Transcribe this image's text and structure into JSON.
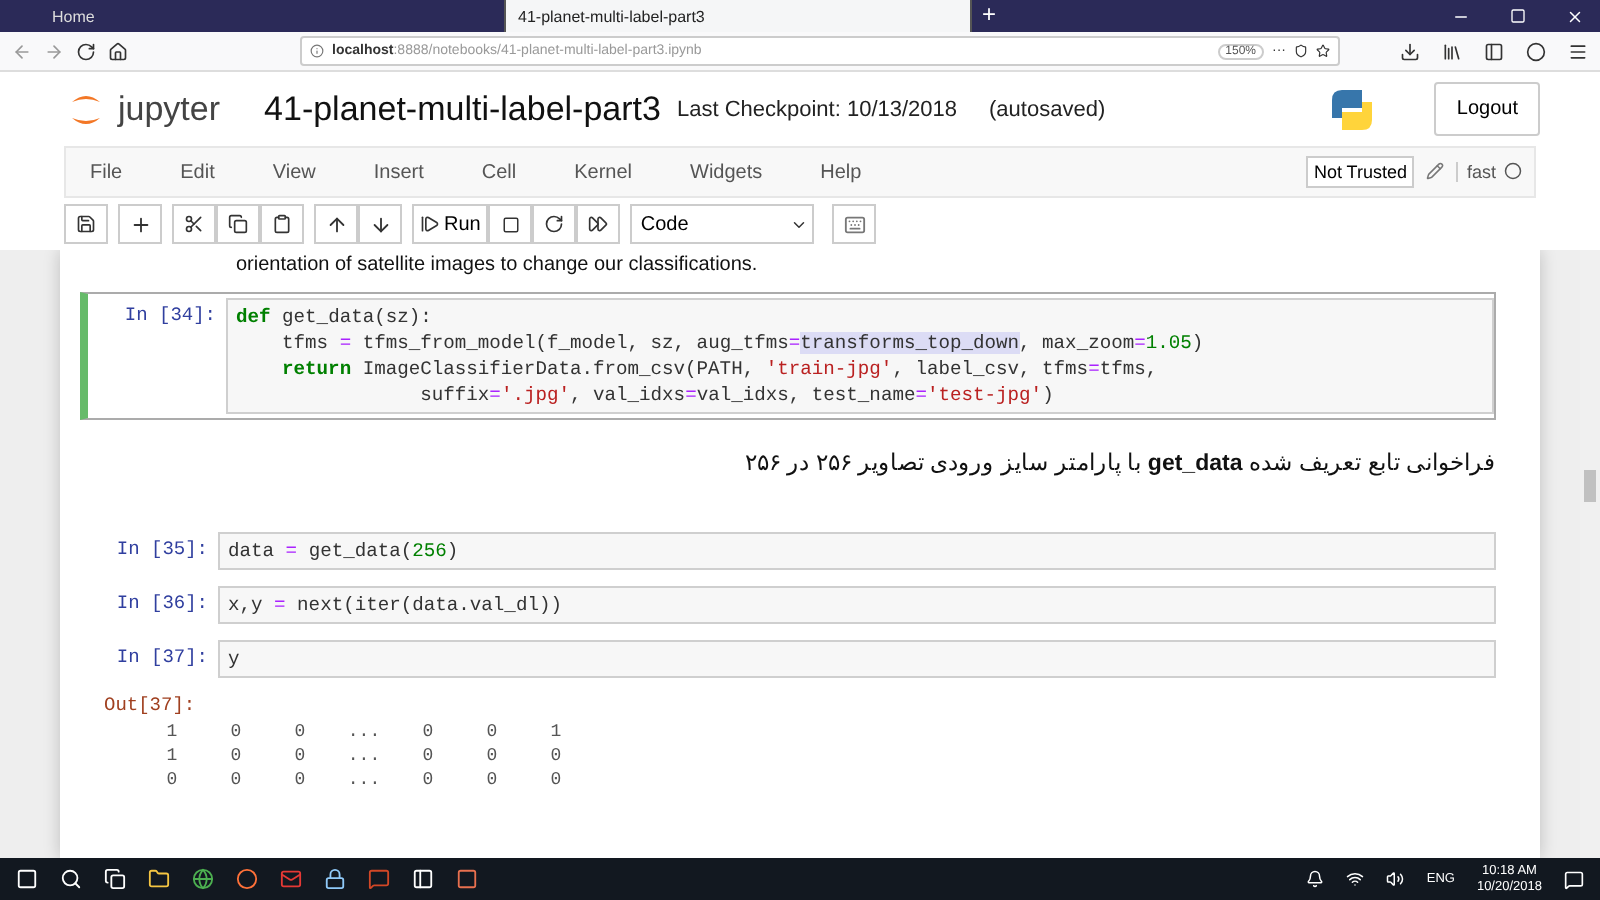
{
  "browser": {
    "tabs": [
      {
        "label": "Home",
        "selected": false
      },
      {
        "label": "41-planet-multi-label-part3",
        "selected": true
      }
    ],
    "new_tab": "+",
    "url_host": "localhost",
    "url_rest": ":8888/notebooks/41-planet-multi-label-part3.ipynb",
    "zoom": "150%",
    "dots": "···"
  },
  "header": {
    "logo_text": "jupyter",
    "title": "41-planet-multi-label-part3",
    "checkpoint": "Last Checkpoint: 10/13/2018",
    "autosaved": "(autosaved)",
    "logout": "Logout"
  },
  "menu": {
    "items": [
      "File",
      "Edit",
      "View",
      "Insert",
      "Cell",
      "Kernel",
      "Widgets",
      "Help"
    ],
    "trusted": "Not Trusted",
    "kernel": "fast"
  },
  "toolbar": {
    "run": "Run",
    "cell_type": "Code"
  },
  "notebook": {
    "intro": "orientation of satellite images to change our classifications.",
    "cells": [
      {
        "kind": "code",
        "prompt": "In [34]:",
        "selected": true,
        "lines": [
          [
            {
              "text": "def",
              "kind": "keyword"
            },
            {
              "text": " get_data(sz):",
              "kind": "plain"
            }
          ],
          [
            {
              "text": "    tfms ",
              "kind": "plain"
            },
            {
              "text": "=",
              "kind": "operator"
            },
            {
              "text": " tfms_from_model(f_model, sz, aug_tfms",
              "kind": "plain"
            },
            {
              "text": "=",
              "kind": "operator"
            },
            {
              "text": "transforms_top_down",
              "kind": "highlight"
            },
            {
              "text": ", max_zoom",
              "kind": "plain"
            },
            {
              "text": "=",
              "kind": "operator"
            },
            {
              "text": "1.05",
              "kind": "number"
            },
            {
              "text": ")",
              "kind": "plain"
            }
          ],
          [
            {
              "text": "    return",
              "kind": "keyword"
            },
            {
              "text": " ImageClassifierData.from_csv(PATH, ",
              "kind": "plain"
            },
            {
              "text": "'train-jpg'",
              "kind": "string"
            },
            {
              "text": ", label_csv, tfms",
              "kind": "plain"
            },
            {
              "text": "=",
              "kind": "operator"
            },
            {
              "text": "tfms,",
              "kind": "plain"
            }
          ],
          [
            {
              "text": "                suffix",
              "kind": "plain"
            },
            {
              "text": "=",
              "kind": "operator"
            },
            {
              "text": "'.jpg'",
              "kind": "string"
            },
            {
              "text": ", val_idxs",
              "kind": "plain"
            },
            {
              "text": "=",
              "kind": "operator"
            },
            {
              "text": "val_idxs, test_name",
              "kind": "plain"
            },
            {
              "text": "=",
              "kind": "operator"
            },
            {
              "text": "'test-jpg'",
              "kind": "string"
            },
            {
              "text": ")",
              "kind": "plain"
            }
          ]
        ]
      },
      {
        "kind": "markdown",
        "text": "فراخوانی تابع تعریف شده **get_data** با پارامتر سایز ورودی تصاویر ۲۵۶ در ۲۵۶"
      },
      {
        "kind": "code",
        "prompt": "In [35]:",
        "selected": false,
        "lines": [
          [
            {
              "text": "data ",
              "kind": "plain"
            },
            {
              "text": "=",
              "kind": "operator"
            },
            {
              "text": " get_data(",
              "kind": "plain"
            },
            {
              "text": "256",
              "kind": "number"
            },
            {
              "text": ")",
              "kind": "plain"
            }
          ]
        ]
      },
      {
        "kind": "code",
        "prompt": "In [36]:",
        "selected": false,
        "lines": [
          [
            {
              "text": "x,y ",
              "kind": "plain"
            },
            {
              "text": "=",
              "kind": "operator"
            },
            {
              "text": " next(iter(data.val_dl))",
              "kind": "plain"
            }
          ]
        ]
      },
      {
        "kind": "code",
        "prompt": "In [37]:",
        "selected": false,
        "lines": [
          [
            {
              "text": "y",
              "kind": "plain"
            }
          ]
        ]
      },
      {
        "kind": "output",
        "prompt": "Out[37]:",
        "rows": [
          [
            "1",
            "0",
            "0",
            "...",
            "0",
            "0",
            "1"
          ],
          [
            "1",
            "0",
            "0",
            "...",
            "0",
            "0",
            "0"
          ],
          [
            "0",
            "0",
            "0",
            "...",
            "0",
            "0",
            "0"
          ]
        ]
      }
    ]
  },
  "taskbar": {
    "lang": "ENG",
    "time": "10:18 AM",
    "date": "10/20/2018"
  }
}
